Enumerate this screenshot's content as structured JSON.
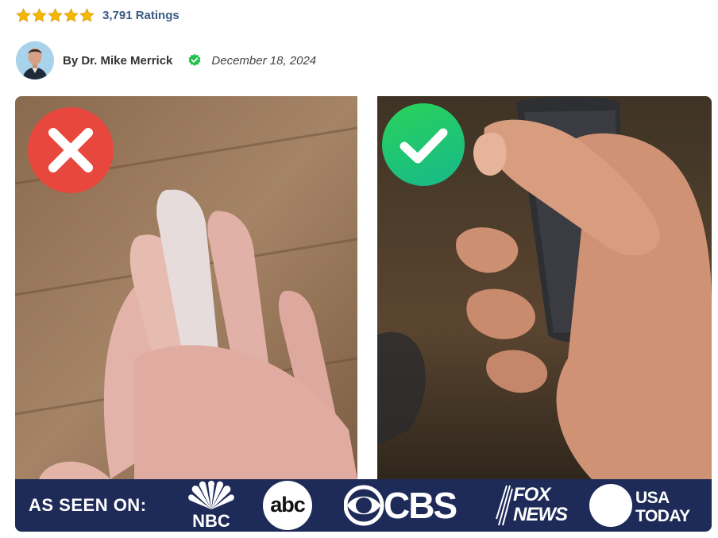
{
  "rating": {
    "stars": 5,
    "text": "3,791 Ratings",
    "star_color": "#f5b800"
  },
  "author": {
    "byline": "By Dr. Mike Merrick",
    "verified_icon": "verified-check-icon",
    "verified_color": "#23c04a",
    "date": "December 18, 2024"
  },
  "comparison": {
    "left_badge_icon": "x-icon",
    "left_badge_color": "#e8473d",
    "right_badge_icon": "checkmark-icon",
    "right_badge_color": "#22c96a"
  },
  "banner": {
    "title": "AS SEEN ON:",
    "background": "#1e2a58",
    "logos": {
      "nbc": "NBC",
      "abc": "abc",
      "cbs": "CBS",
      "fox_line1": "FOX",
      "fox_line2": "NEWS",
      "usa_line1": "USA",
      "usa_line2": "TODAY"
    }
  }
}
